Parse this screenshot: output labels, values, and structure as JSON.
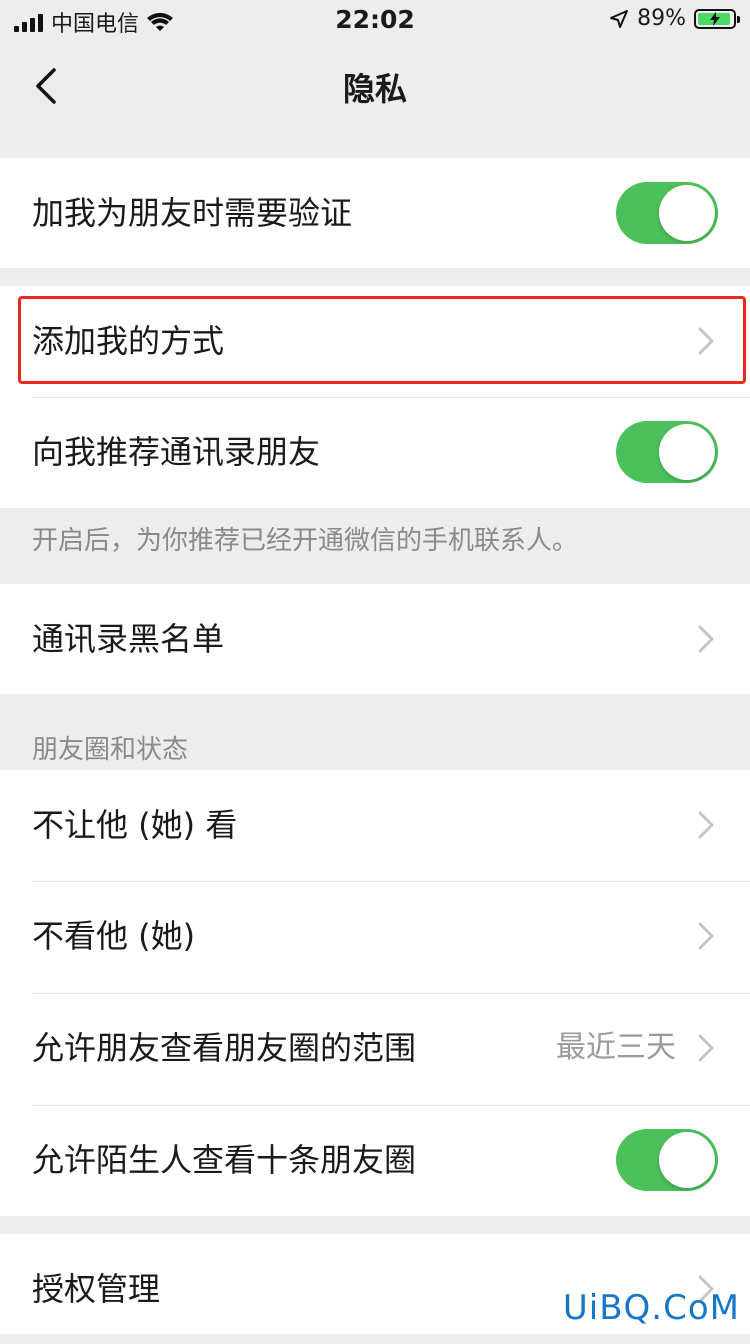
{
  "status_bar": {
    "carrier": "中国电信",
    "time": "22:02",
    "battery": "89%"
  },
  "nav": {
    "title": "隐私"
  },
  "cells": {
    "verify": {
      "label": "加我为朋友时需要验证",
      "on": true
    },
    "add_method": {
      "label": "添加我的方式"
    },
    "recommend": {
      "label": "向我推荐通讯录朋友",
      "on": true
    },
    "recommend_note": "开启后，为你推荐已经开通微信的手机联系人。",
    "blacklist": {
      "label": "通讯录黑名单"
    },
    "moments_header": "朋友圈和状态",
    "hide_from": {
      "label": "不让他 (她) 看"
    },
    "dont_see": {
      "label": "不看他 (她)"
    },
    "range": {
      "label": "允许朋友查看朋友圈的范围",
      "value": "最近三天"
    },
    "strangers": {
      "label": "允许陌生人查看十条朋友圈",
      "on": true
    },
    "auth": {
      "label": "授权管理"
    }
  },
  "colors": {
    "toggle_on": "#4cc05a",
    "highlight": "#e8291c"
  },
  "watermark": "UiBQ.CoM"
}
